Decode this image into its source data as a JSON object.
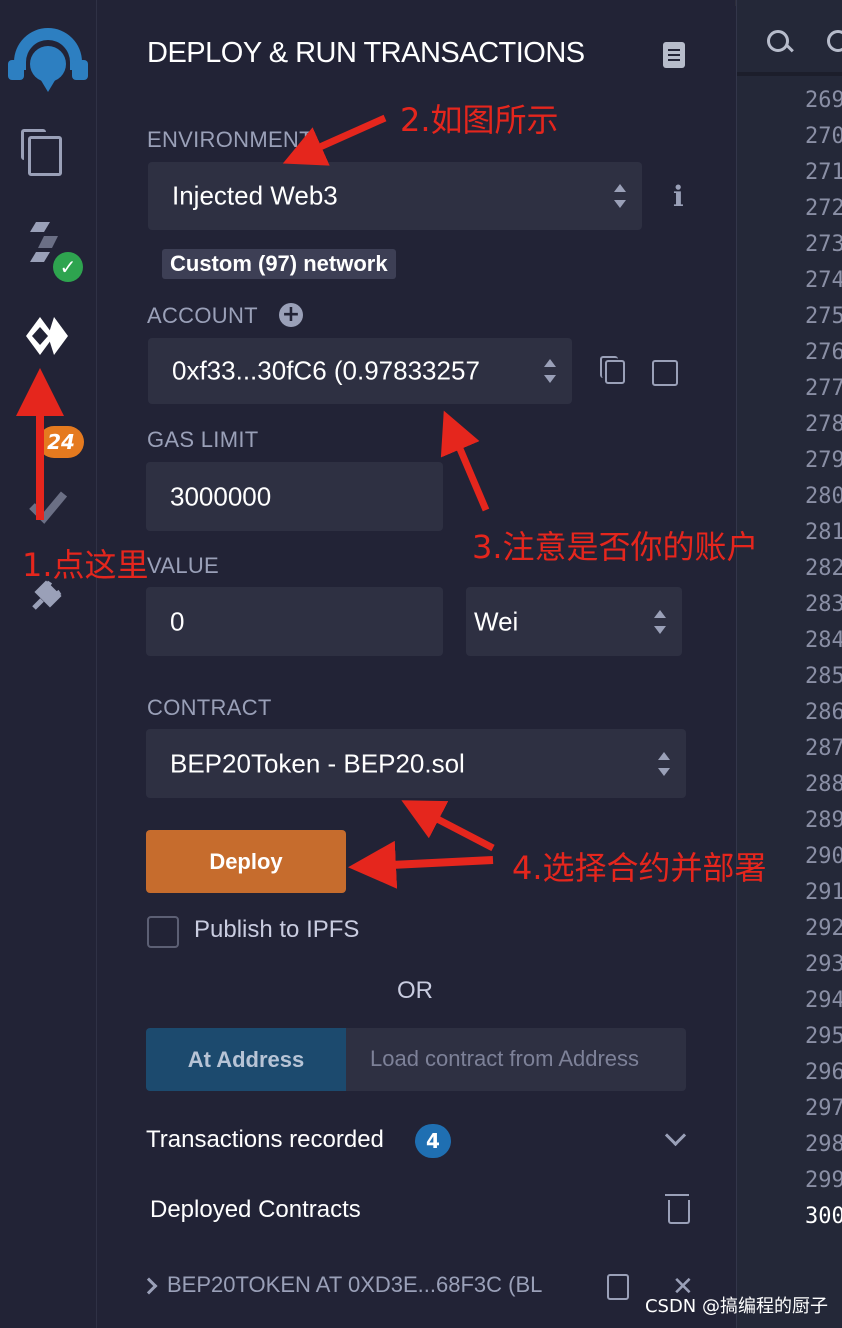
{
  "panel": {
    "title": "DEPLOY & RUN TRANSACTIONS",
    "environment": {
      "label": "ENVIRONMENT",
      "value": "Injected Web3",
      "network_badge": "Custom (97) network"
    },
    "account": {
      "label": "ACCOUNT",
      "value": "0xf33...30fC6 (0.97833257"
    },
    "gas_limit": {
      "label": "GAS LIMIT",
      "value": "3000000"
    },
    "value": {
      "label": "VALUE",
      "amount": "0",
      "unit": "Wei"
    },
    "contract": {
      "label": "CONTRACT",
      "value": "BEP20Token - BEP20.sol"
    },
    "deploy_label": "Deploy",
    "publish_label": "Publish to IPFS",
    "or_label": "OR",
    "at_address_label": "At Address",
    "load_placeholder": "Load contract from Address",
    "transactions_recorded": {
      "label": "Transactions recorded",
      "count": "4"
    },
    "deployed_contracts_label": "Deployed Contracts",
    "deployed_item": "BEP20TOKEN AT 0XD3E...68F3C (BL"
  },
  "iconbar": {
    "plugin_badge": "24"
  },
  "editor": {
    "line_numbers": [
      "269",
      "270",
      "271",
      "272",
      "273",
      "274",
      "275",
      "276",
      "277",
      "278",
      "279",
      "280",
      "281",
      "282",
      "283",
      "284",
      "285",
      "286",
      "287",
      "288",
      "289",
      "290",
      "291",
      "292",
      "293",
      "294",
      "295",
      "296",
      "297",
      "298",
      "299",
      "300"
    ]
  },
  "annotations": {
    "step1": "1.点这里",
    "step2": "2.如图所示",
    "step3": "3.注意是否你的账户",
    "step4": "4.选择合约并部署"
  },
  "watermark": "CSDN @搞编程的厨子",
  "colors": {
    "accent_orange": "#c66c2d",
    "annotation_red": "#e5261d",
    "bg": "#222336"
  }
}
